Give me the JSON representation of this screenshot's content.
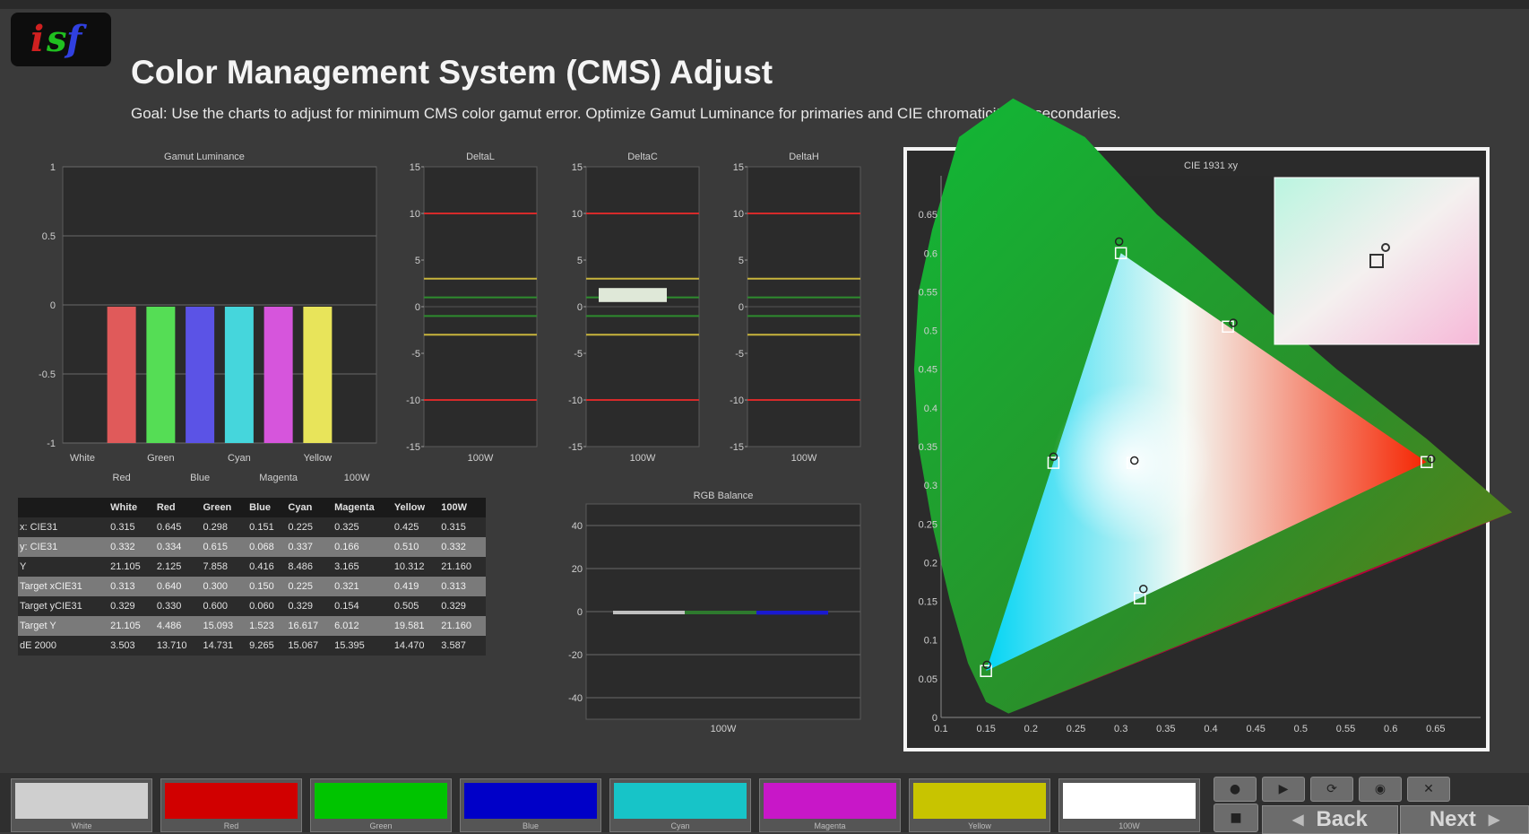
{
  "header": {
    "title": "Color Management System (CMS) Adjust",
    "subtitle": "Goal: Use the charts to adjust for minimum CMS color gamut error. Optimize Gamut Luminance for primaries and CIE chromaticity for secondaries.",
    "logo_text": "isf"
  },
  "chart_data": [
    {
      "id": "gamut",
      "type": "bar",
      "title": "Gamut Luminance",
      "ylim": [
        -1,
        1
      ],
      "yticks": [
        "1",
        "0.5",
        "0",
        "-0.5",
        "-1"
      ],
      "categories": [
        "White",
        "Red",
        "Green",
        "Blue",
        "Cyan",
        "Magenta",
        "Yellow",
        "100W"
      ],
      "values": [
        0,
        -1,
        -1,
        -1,
        -1,
        -1,
        -1,
        0
      ],
      "colors": [
        "#dddddd",
        "#e05a5a",
        "#55dd55",
        "#5b53e6",
        "#45d6dc",
        "#d655dc",
        "#e8e45a",
        "#dddddd"
      ],
      "grid": true
    },
    {
      "id": "dl",
      "type": "line",
      "title": "DeltaL",
      "ylim": [
        -15,
        15
      ],
      "yticks": [
        "15",
        "10",
        "5",
        "0",
        "-5",
        "-10",
        "-15"
      ],
      "xlabel": "100W",
      "thresholds": [
        {
          "value": 10,
          "color": "#d62a2a"
        },
        {
          "value": 3,
          "color": "#c8b43c"
        },
        {
          "value": 1,
          "color": "#2e8b2e"
        },
        {
          "value": -1,
          "color": "#2e8b2e"
        },
        {
          "value": -3,
          "color": "#c8b43c"
        },
        {
          "value": -10,
          "color": "#d62a2a"
        }
      ],
      "bar": null
    },
    {
      "id": "dc",
      "type": "bar",
      "title": "DeltaC",
      "ylim": [
        -15,
        15
      ],
      "yticks": [
        "15",
        "10",
        "5",
        "0",
        "-5",
        "-10",
        "-15"
      ],
      "xlabel": "100W",
      "thresholds": [
        {
          "value": 10,
          "color": "#d62a2a"
        },
        {
          "value": 3,
          "color": "#c8b43c"
        },
        {
          "value": 1,
          "color": "#2e8b2e"
        },
        {
          "value": -1,
          "color": "#2e8b2e"
        },
        {
          "value": -3,
          "color": "#c8b43c"
        },
        {
          "value": -10,
          "color": "#d62a2a"
        }
      ],
      "bar": {
        "from": 0.5,
        "to": 2,
        "color": "#dfe8d8"
      }
    },
    {
      "id": "dh",
      "type": "line",
      "title": "DeltaH",
      "ylim": [
        -15,
        15
      ],
      "yticks": [
        "15",
        "10",
        "5",
        "0",
        "-5",
        "-10",
        "-15"
      ],
      "xlabel": "100W",
      "thresholds": [
        {
          "value": 10,
          "color": "#d62a2a"
        },
        {
          "value": 3,
          "color": "#c8b43c"
        },
        {
          "value": 1,
          "color": "#2e8b2e"
        },
        {
          "value": -1,
          "color": "#2e8b2e"
        },
        {
          "value": -3,
          "color": "#c8b43c"
        },
        {
          "value": -10,
          "color": "#d62a2a"
        }
      ],
      "bar": null
    },
    {
      "id": "rgb",
      "type": "bar",
      "title": "RGB Balance",
      "ylim": [
        -50,
        50
      ],
      "yticks": [
        "40",
        "20",
        "0",
        "-20",
        "-40"
      ],
      "xlabel": "100W",
      "series": [
        {
          "color": "#c0c0c0",
          "value": 0
        },
        {
          "color": "#2e7a2e",
          "value": 0
        },
        {
          "color": "#1a1ad0",
          "value": -1
        }
      ]
    },
    {
      "id": "cie",
      "type": "scatter",
      "title": "CIE 1931 xy",
      "xlim": [
        0.1,
        0.7
      ],
      "ylim": [
        0,
        0.7
      ],
      "xticks": [
        "0.1",
        "0.15",
        "0.2",
        "0.25",
        "0.3",
        "0.35",
        "0.4",
        "0.45",
        "0.5",
        "0.55",
        "0.6",
        "0.65"
      ],
      "yticks": [
        "0.65",
        "0.6",
        "0.55",
        "0.5",
        "0.45",
        "0.4",
        "0.35",
        "0.3",
        "0.25",
        "0.2",
        "0.15",
        "0.1",
        "0.05",
        "0"
      ],
      "targets": [
        {
          "name": "Red",
          "x": 0.64,
          "y": 0.33
        },
        {
          "name": "Green",
          "x": 0.3,
          "y": 0.6
        },
        {
          "name": "Blue",
          "x": 0.15,
          "y": 0.06
        },
        {
          "name": "Cyan",
          "x": 0.225,
          "y": 0.329
        },
        {
          "name": "Magenta",
          "x": 0.321,
          "y": 0.154
        },
        {
          "name": "Yellow",
          "x": 0.419,
          "y": 0.505
        },
        {
          "name": "White",
          "x": 0.313,
          "y": 0.329
        }
      ],
      "measured": [
        {
          "name": "Red",
          "x": 0.645,
          "y": 0.334
        },
        {
          "name": "Green",
          "x": 0.298,
          "y": 0.615
        },
        {
          "name": "Blue",
          "x": 0.151,
          "y": 0.068
        },
        {
          "name": "Cyan",
          "x": 0.225,
          "y": 0.337
        },
        {
          "name": "Magenta",
          "x": 0.325,
          "y": 0.166
        },
        {
          "name": "Yellow",
          "x": 0.425,
          "y": 0.51
        },
        {
          "name": "White",
          "x": 0.315,
          "y": 0.332
        }
      ]
    }
  ],
  "table": {
    "headers": [
      "",
      "White",
      "Red",
      "Green",
      "Blue",
      "Cyan",
      "Magenta",
      "Yellow",
      "100W"
    ],
    "rows": [
      [
        "x: CIE31",
        "0.315",
        "0.645",
        "0.298",
        "0.151",
        "0.225",
        "0.325",
        "0.425",
        "0.315"
      ],
      [
        "y: CIE31",
        "0.332",
        "0.334",
        "0.615",
        "0.068",
        "0.337",
        "0.166",
        "0.510",
        "0.332"
      ],
      [
        "Y",
        "21.105",
        "2.125",
        "7.858",
        "0.416",
        "8.486",
        "3.165",
        "10.312",
        "21.160"
      ],
      [
        "Target xCIE31",
        "0.313",
        "0.640",
        "0.300",
        "0.150",
        "0.225",
        "0.321",
        "0.419",
        "0.313"
      ],
      [
        "Target yCIE31",
        "0.329",
        "0.330",
        "0.600",
        "0.060",
        "0.329",
        "0.154",
        "0.505",
        "0.329"
      ],
      [
        "Target Y",
        "21.105",
        "4.486",
        "15.093",
        "1.523",
        "16.617",
        "6.012",
        "19.581",
        "21.160"
      ],
      [
        "dE 2000",
        "3.503",
        "13.710",
        "14.731",
        "9.265",
        "15.067",
        "15.395",
        "14.470",
        "3.587"
      ]
    ]
  },
  "swatches": [
    {
      "label": "White",
      "color": "#cfcfcf"
    },
    {
      "label": "Red",
      "color": "#d10000"
    },
    {
      "label": "Green",
      "color": "#00c400"
    },
    {
      "label": "Blue",
      "color": "#0000c8"
    },
    {
      "label": "Cyan",
      "color": "#17c4c8"
    },
    {
      "label": "Magenta",
      "color": "#c817c8"
    },
    {
      "label": "Yellow",
      "color": "#c8c400"
    },
    {
      "label": "100W",
      "color": "#ffffff"
    }
  ],
  "nav": {
    "back": "Back",
    "next": "Next"
  },
  "controls": [
    "record-icon",
    "play-icon",
    "repeat-icon",
    "camera-icon",
    "trash-icon"
  ]
}
